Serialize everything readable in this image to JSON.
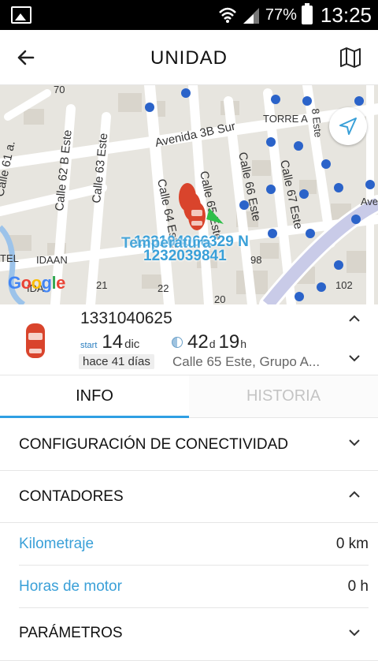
{
  "status_bar": {
    "battery": "77%",
    "time": "13:25"
  },
  "header": {
    "title": "UNIDAD"
  },
  "map": {
    "streets": [
      "Avenida 3B Sur",
      "Calle 62 B Este",
      "Calle 63 Este",
      "Calle 64 Este",
      "Calle 65 Este",
      "Calle 66 Este",
      "Calle 67 Este",
      "Calle 61 a.",
      "TORRE A",
      "Ave"
    ],
    "numbers": [
      "70",
      "21",
      "22",
      "20",
      "98",
      "102",
      "8 Este"
    ],
    "places": [
      "TEL",
      "IDAAN",
      "IDA"
    ],
    "unit_overlay_1": "133104066329 N",
    "unit_overlay_2": "Temperatura",
    "unit_overlay_3": "1232039841",
    "google": [
      "G",
      "o",
      "o",
      "g",
      "l",
      "e"
    ]
  },
  "unit": {
    "id": "1331040625",
    "start_label": "start",
    "start_day": "14",
    "start_month": "dic",
    "duration_days": "42",
    "duration_days_unit": "d",
    "duration_hours": "19",
    "duration_hours_unit": "h",
    "ago": "hace 41 días",
    "address": "Calle 65 Este, Grupo A..."
  },
  "tabs": [
    {
      "label": "INFO",
      "active": true
    },
    {
      "label": "HISTORIA",
      "active": false
    }
  ],
  "sections": {
    "connectivity": "CONFIGURACIÓN DE CONECTIVIDAD",
    "counters": "CONTADORES",
    "parameters": "PARÁMETROS"
  },
  "counters": [
    {
      "label": "Kilometraje",
      "value": "0 km"
    },
    {
      "label": "Horas de motor",
      "value": "0 h"
    }
  ],
  "colors": {
    "accent": "#2f9fe3",
    "link": "#3aa0d8"
  }
}
